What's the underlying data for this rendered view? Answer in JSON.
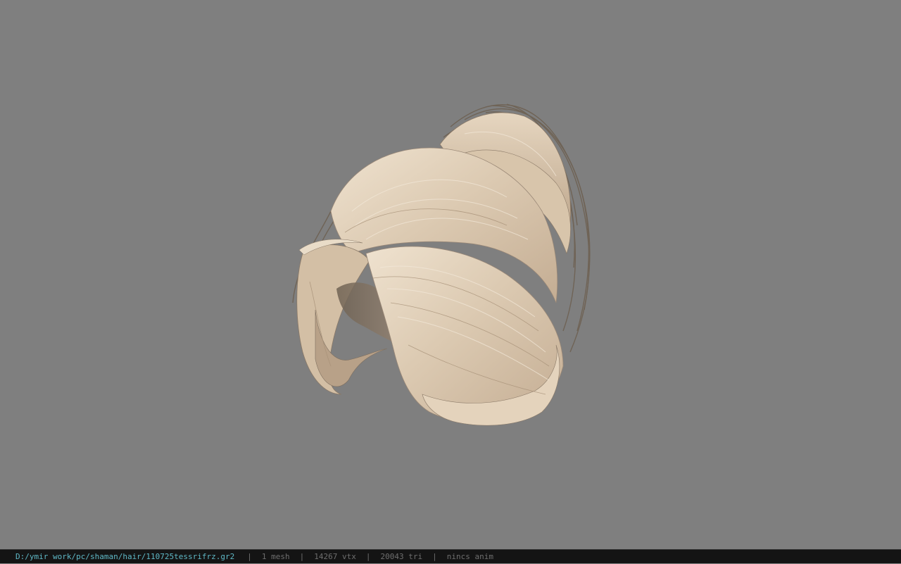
{
  "viewport": {
    "model": "hair-mesh",
    "background_color": "#7f7f7f",
    "hair_light_color": "#e8d9c3",
    "hair_mid_color": "#cdb79e",
    "hair_dark_color": "#8a7967"
  },
  "status_bar": {
    "file_path": "D:/ymir work/pc/shaman/hair/110725tessrifrz.gr2",
    "separator": "|",
    "mesh_count": "1 mesh",
    "vertex_count": "14267 vtx",
    "triangle_count": "20043 tri",
    "anim_status": "nincs anim",
    "path_color": "#5fb8c6",
    "text_color": "#6e6e6e"
  }
}
